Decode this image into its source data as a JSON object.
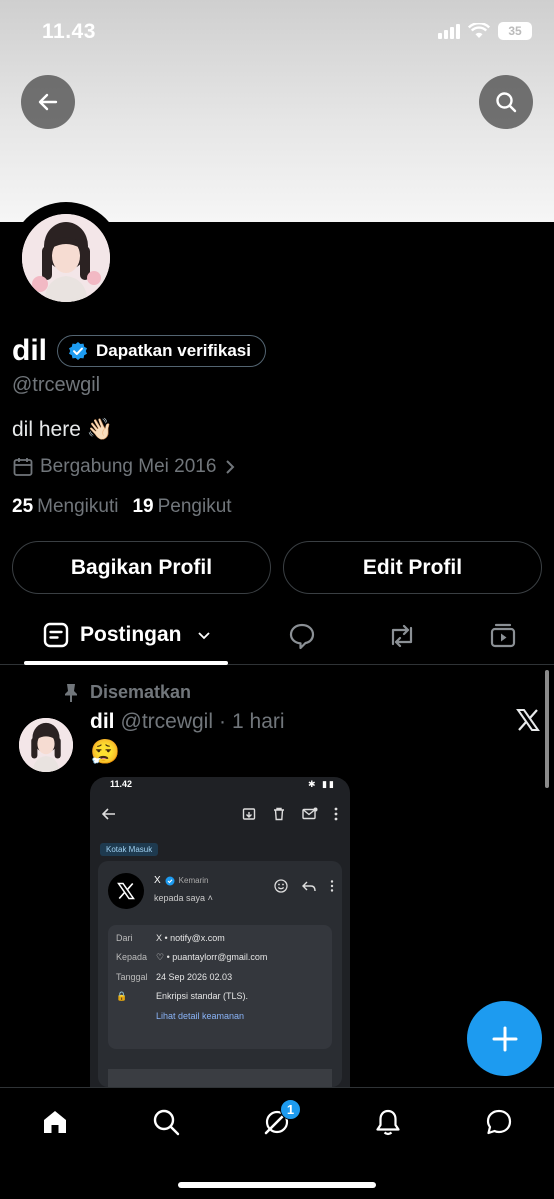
{
  "status_bar": {
    "time": "11.43",
    "battery": "35"
  },
  "profile": {
    "name": "dil",
    "verify_label": "Dapatkan verifikasi",
    "handle": "@trcewgil",
    "bio": "dil here 👋🏻",
    "joined": "Bergabung Mei 2016",
    "following_count": "25",
    "following_label": "Mengikuti",
    "followers_count": "19",
    "followers_label": "Pengikut",
    "share_label": "Bagikan Profil",
    "edit_label": "Edit Profil"
  },
  "tabs": {
    "active_label": "Postingan"
  },
  "post": {
    "pinned_label": "Disematkan",
    "author": "dil",
    "handle": "@trcewgil",
    "separator": "·",
    "time": "1 hari",
    "content": "😮‍💨"
  },
  "embedded_screenshot": {
    "time": "11.42",
    "folder_label": "Kotak Masuk",
    "sender": "X",
    "when": "Kemarin",
    "to_line": "kepada saya",
    "details": {
      "from_key": "Dari",
      "from_val": "X • notify@x.com",
      "to_key": "Kepada",
      "to_val": "♡ • puantaylorr@gmail.com",
      "date_key": "Tanggal",
      "date_val": "24 Sep 2026 02.03",
      "security_val": "Enkripsi standar (TLS).",
      "security_link": "Lihat detail keamanan"
    }
  },
  "bottom_nav": {
    "notification_badge": "1"
  },
  "colors": {
    "accent": "#1d9bf0",
    "background": "#000000",
    "muted": "#71767b"
  }
}
